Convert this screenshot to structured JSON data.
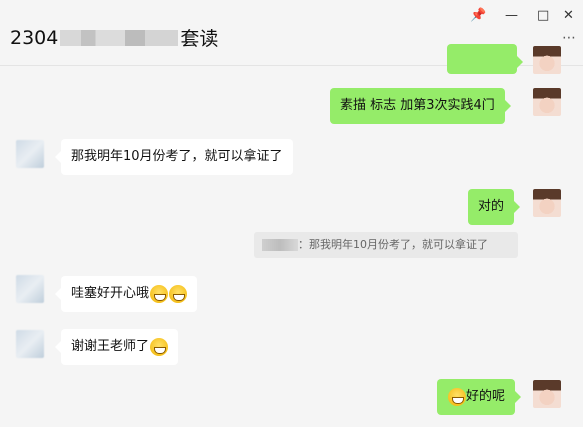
{
  "header": {
    "title_prefix": "2304",
    "title_suffix": "套读",
    "pin_icon": "pin-icon",
    "minimize_icon": "minimize-icon",
    "maximize_icon": "maximize-icon",
    "close_icon": "close-icon",
    "more_icon": "more-icon"
  },
  "messages": [
    {
      "side": "right",
      "text": "素描 标志  加第3次实践4门"
    },
    {
      "side": "left",
      "text": "那我明年10月份考了，就可以拿证了"
    },
    {
      "side": "right",
      "text": "对的"
    },
    {
      "side": "quote",
      "text": "：那我明年10月份考了，就可以拿证了"
    },
    {
      "side": "left",
      "text": "哇塞好开心哦"
    },
    {
      "side": "left",
      "text": "谢谢王老师了"
    },
    {
      "side": "right",
      "text": "好的呢"
    }
  ],
  "colors": {
    "my_bubble": "#95ec69",
    "their_bubble": "#ffffff",
    "background": "#f5f5f5"
  }
}
